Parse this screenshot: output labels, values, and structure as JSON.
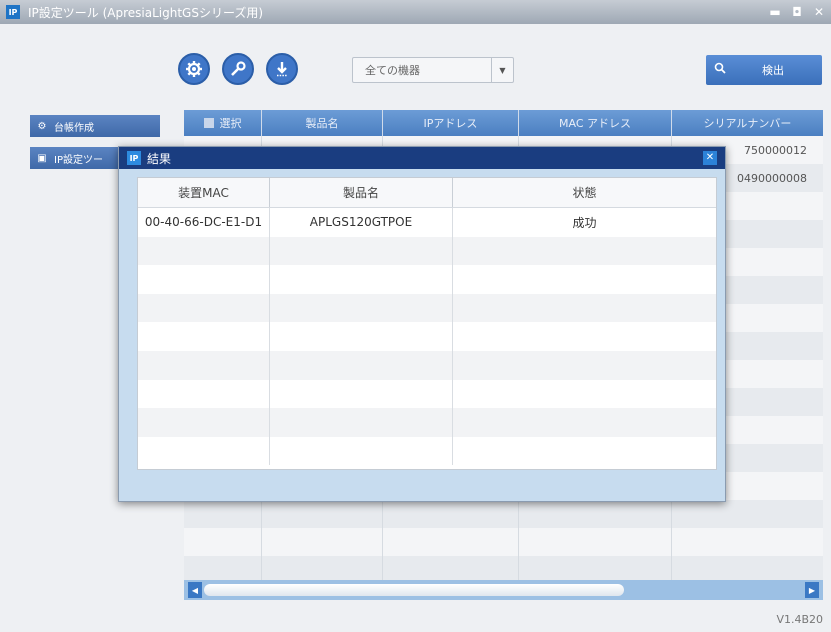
{
  "window": {
    "title": "IP設定ツール (ApresiaLightGSシリーズ用)",
    "app_badge": "IP",
    "controls": [
      "▬",
      "◘",
      "✕"
    ]
  },
  "toolbar": {
    "filter_value": "全ての機器",
    "detect_label": "検出"
  },
  "side": {
    "ledger_label": "台帳作成",
    "ipconfig_label": "IP設定ツー"
  },
  "device_table": {
    "columns": [
      "選択",
      "製品名",
      "IPアドレス",
      "MAC アドレス",
      "シリアルナンバー"
    ],
    "rows": [
      [
        "",
        "",
        "",
        "",
        "750000012"
      ],
      [
        "",
        "",
        "",
        "",
        "0490000008"
      ],
      [
        "",
        "",
        "",
        "",
        ""
      ],
      [
        "",
        "",
        "",
        "",
        ""
      ],
      [
        "",
        "",
        "",
        "",
        ""
      ],
      [
        "",
        "",
        "",
        "",
        ""
      ],
      [
        "",
        "",
        "",
        "",
        ""
      ],
      [
        "",
        "",
        "",
        "",
        ""
      ],
      [
        "",
        "",
        "",
        "",
        ""
      ],
      [
        "",
        "",
        "",
        "",
        ""
      ],
      [
        "",
        "",
        "",
        "",
        ""
      ],
      [
        "",
        "",
        "",
        "",
        ""
      ],
      [
        "",
        "",
        "",
        "",
        ""
      ],
      [
        "",
        "",
        "",
        "",
        ""
      ],
      [
        "",
        "",
        "",
        "",
        ""
      ],
      [
        "",
        "",
        "",
        "",
        ""
      ]
    ]
  },
  "version": "V1.4B20",
  "dialog": {
    "badge": "IP",
    "title": "結果",
    "close": "✕",
    "columns": [
      "装置MAC",
      "製品名",
      "状態"
    ],
    "rows": [
      [
        "00-40-66-DC-E1-D1",
        "APLGS120GTPOE",
        "成功"
      ],
      [
        "",
        "",
        ""
      ],
      [
        "",
        "",
        ""
      ],
      [
        "",
        "",
        ""
      ],
      [
        "",
        "",
        ""
      ],
      [
        "",
        "",
        ""
      ],
      [
        "",
        "",
        ""
      ],
      [
        "",
        "",
        ""
      ],
      [
        "",
        "",
        ""
      ]
    ]
  }
}
